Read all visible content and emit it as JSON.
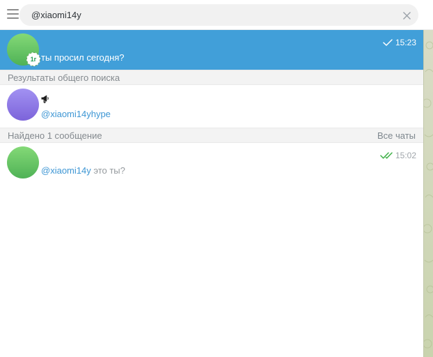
{
  "topbar": {
    "search_value": "@xiaomi14y"
  },
  "selected_chat": {
    "name": "",
    "preview": "ты просил сегодня?",
    "time": "15:23",
    "ttl_badge": "1г"
  },
  "sections": {
    "global_search": "Результаты общего поиска",
    "found_label": "Найдено 1 сообщение",
    "all_chats": "Все чаты"
  },
  "global_result": {
    "name": "",
    "username": "@xiaomi14yhype"
  },
  "message_result": {
    "name": "",
    "highlight": "@xiaomi14y",
    "rest": " это ты?",
    "time": "15:02"
  },
  "icons": {
    "menu": "hamburger-icon",
    "clear": "close-icon",
    "channel": "megaphone-icon",
    "sent": "single-check-icon",
    "read": "double-check-icon"
  },
  "colors": {
    "selected_bg": "#419fd9",
    "link": "#3d96d4",
    "read_check": "#45b34d",
    "section_bg": "#f3f3f3",
    "pattern_base": "#d3d9bd"
  }
}
